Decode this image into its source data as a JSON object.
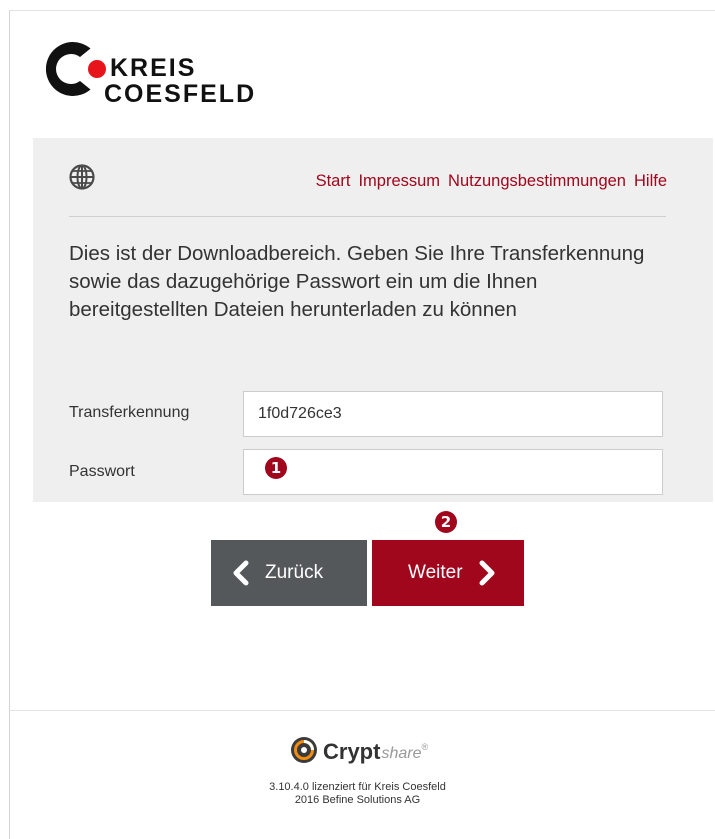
{
  "header": {
    "logo_text_line1": "KREIS",
    "logo_text_line2": "COESFELD",
    "brand_color": "#a0061c"
  },
  "nav": {
    "icon": "globe-icon",
    "links": [
      "Start",
      "Impressum",
      "Nutzungsbestimmungen",
      "Hilfe"
    ]
  },
  "intro": {
    "text": "Dies ist der Downloadbereich. Geben Sie Ihre Transferkennung sowie das dazugehörige Passwort ein um die Ihnen bereitgestellten Dateien herunterladen zu können"
  },
  "form": {
    "transfer_label": "Transferkennung",
    "transfer_value": "1f0d726ce3",
    "password_label": "Passwort",
    "password_value": ""
  },
  "markers": {
    "one": "1",
    "two": "2"
  },
  "buttons": {
    "back_label": "Zurück",
    "next_label": "Weiter",
    "back_color": "#54585a",
    "next_color": "#a0061c"
  },
  "footer": {
    "product_strong": "Crypt",
    "product_light": "share",
    "registered": "®",
    "license_line": "3.10.4.0 lizenziert für Kreis Coesfeld",
    "copyright_line": "2016 Befine Solutions AG"
  }
}
